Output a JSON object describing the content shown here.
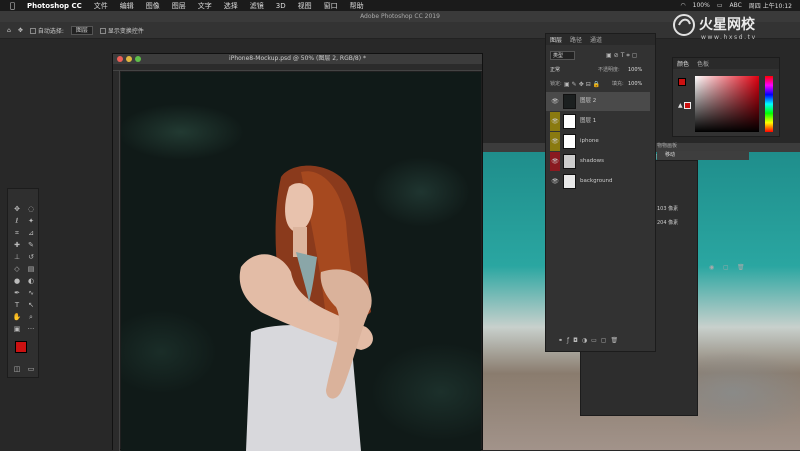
{
  "menubar": {
    "app": "Photoshop CC",
    "items": [
      "文件",
      "编辑",
      "图像",
      "图层",
      "文字",
      "选择",
      "滤镜",
      "3D",
      "视图",
      "窗口",
      "帮助"
    ],
    "battery": "100%",
    "input": "ABC",
    "clock": "周四 上午10:12"
  },
  "app_title": "Adobe Photoshop CC 2019",
  "options": {
    "auto_select_label": "自动选择:",
    "auto_select_value": "图层",
    "show_transform_label": "显示变换控件"
  },
  "document": {
    "title": "iPhone8-Mockup.psd @ 50% (图层 2, RGB/8) *"
  },
  "layers_panel": {
    "tabs": [
      "图层",
      "路径",
      "通道"
    ],
    "kind_label": "类型",
    "blend_mode": "正常",
    "opacity_label": "不透明度:",
    "opacity_value": "100%",
    "lock_label": "锁定:",
    "fill_label": "填充:",
    "fill_value": "100%",
    "layers": [
      {
        "name": "图层 2"
      },
      {
        "name": "图层 1"
      },
      {
        "name": "iphone"
      },
      {
        "name": "shadows"
      },
      {
        "name": "background"
      }
    ]
  },
  "color_panel": {
    "tabs": [
      "颜色",
      "色板"
    ]
  },
  "props_panel": {
    "items": [
      "打?",
      "物物画板",
      "移动"
    ],
    "sizes": [
      "103 像素",
      "204 像素"
    ]
  },
  "watermark": {
    "brand": "火星网校",
    "url": "www.hxsd.tv"
  },
  "colors": {
    "foreground": "#cc1111",
    "background": "#ffffff",
    "accent_layer_olive": "#8a7a10",
    "accent_layer_red": "#8a1a20"
  }
}
